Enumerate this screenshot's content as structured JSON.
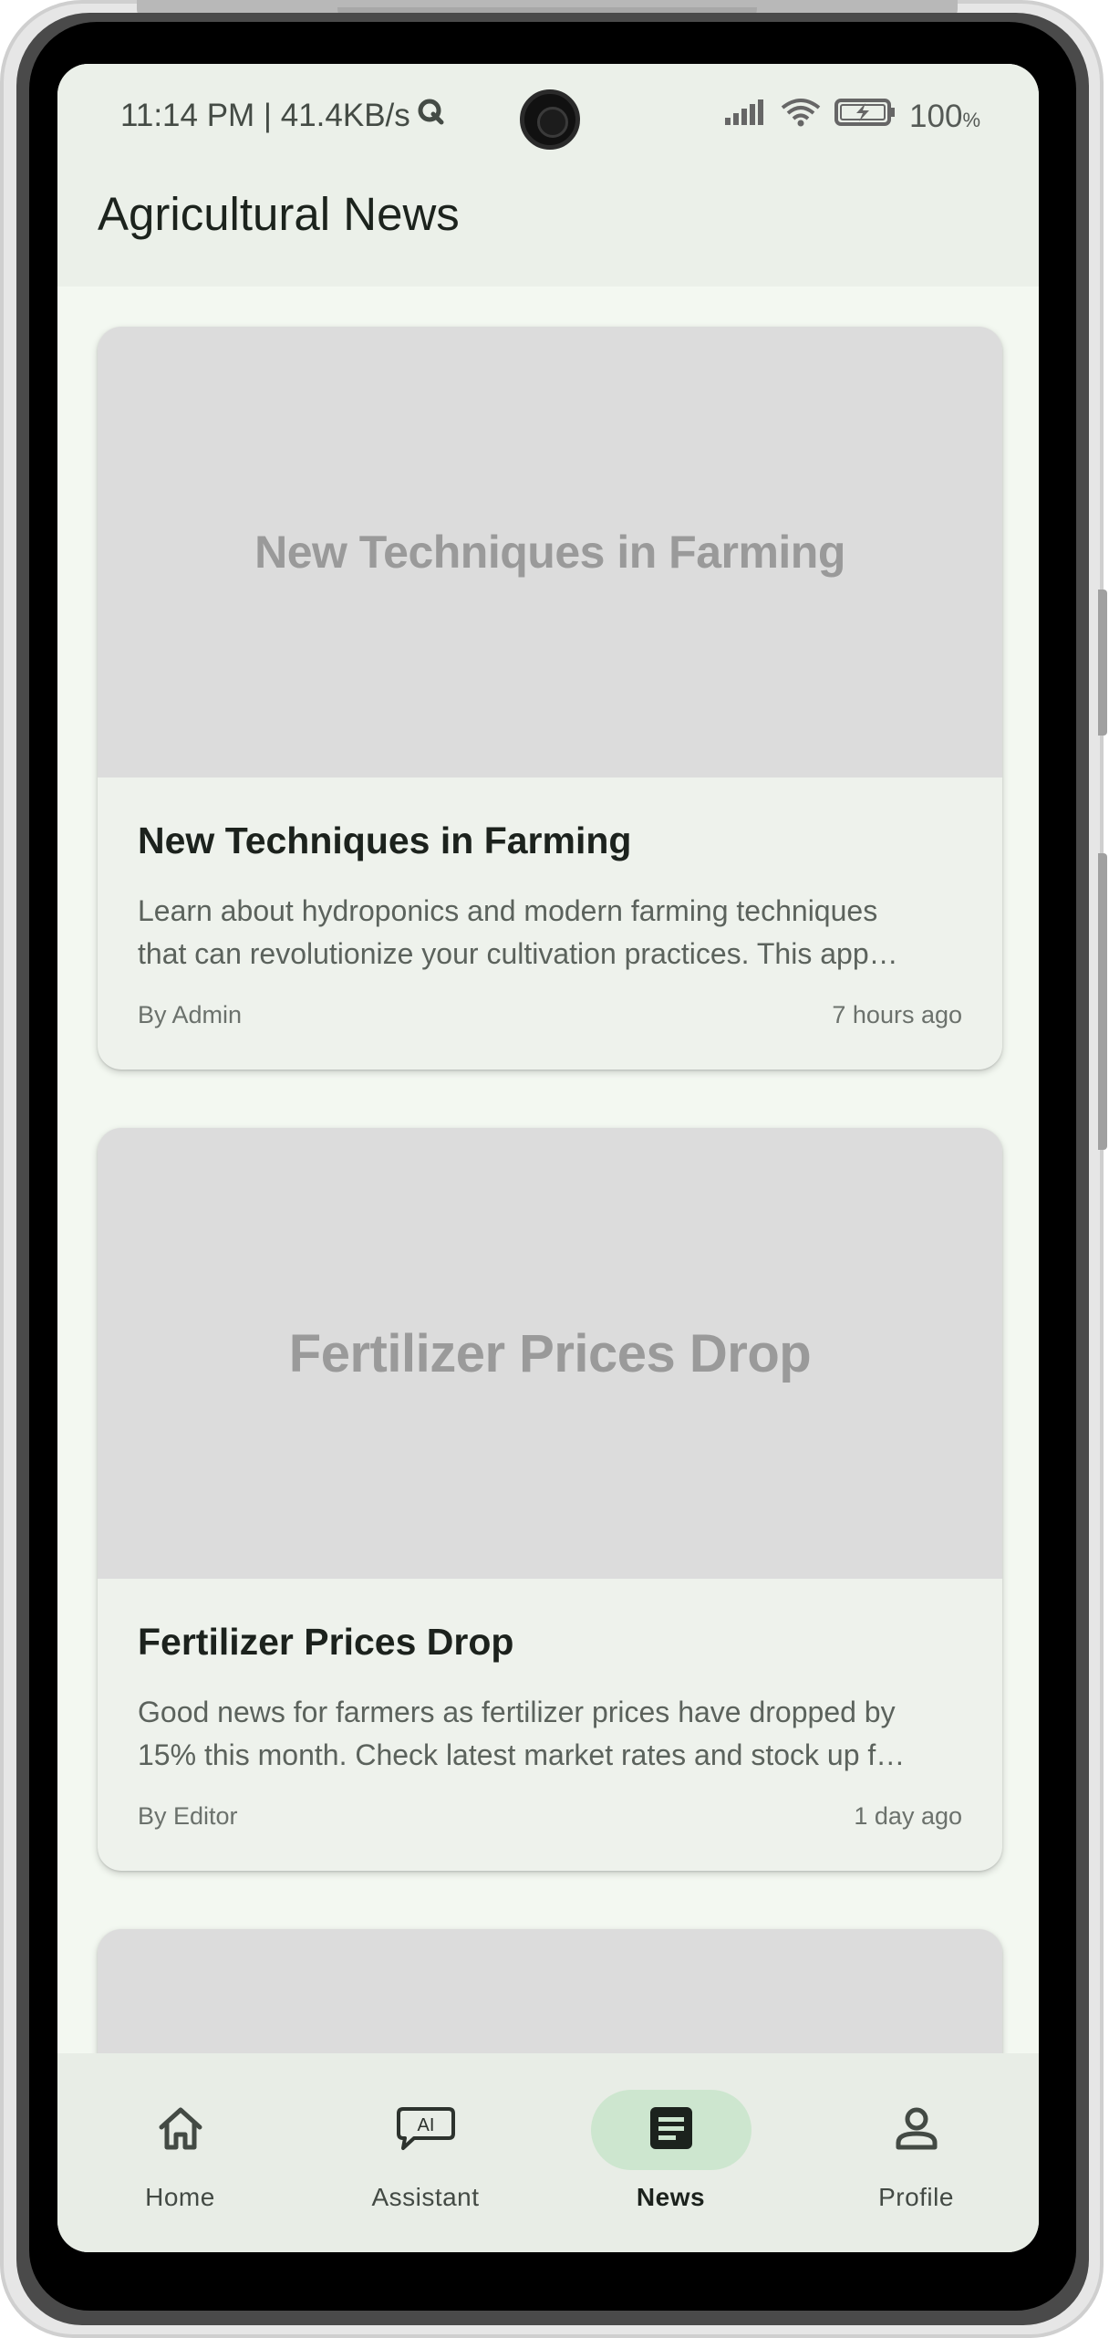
{
  "status_bar": {
    "time": "11:14 PM | 41.4KB/s",
    "battery": "100",
    "battery_unit": "%",
    "icons": [
      "q-app-icon",
      "signal-icon",
      "wifi-icon",
      "battery-charging-icon"
    ]
  },
  "app_bar": {
    "title": "Agricultural News"
  },
  "articles": [
    {
      "image_text": "New Techniques in Farming",
      "title": "New Techniques in Farming",
      "excerpt_line1": "Learn about hydroponics and modern farming techniques",
      "excerpt_line2": "that can revolutionize your cultivation practices. This app…",
      "author": "By Admin",
      "time": "7 hours ago"
    },
    {
      "image_text": "Fertilizer Prices Drop",
      "title": "Fertilizer Prices Drop",
      "excerpt_line1": "Good news for farmers as fertilizer prices have dropped by",
      "excerpt_line2": "15% this month. Check latest market rates and stock up f…",
      "author": "By Editor",
      "time": "1 day ago"
    }
  ],
  "bottom_nav": {
    "items": [
      {
        "label": "Home",
        "icon": "home-icon",
        "active": false
      },
      {
        "label": "Assistant",
        "icon": "ai-chat-icon",
        "active": false
      },
      {
        "label": "News",
        "icon": "article-icon",
        "active": true
      },
      {
        "label": "Profile",
        "icon": "person-icon",
        "active": false
      }
    ]
  },
  "colors": {
    "background": "#f3f8f1",
    "app_bar": "#ebf0e9",
    "card": "#eef2ec",
    "image_placeholder": "#dcdcdc",
    "active_pill": "#cde6cf"
  }
}
